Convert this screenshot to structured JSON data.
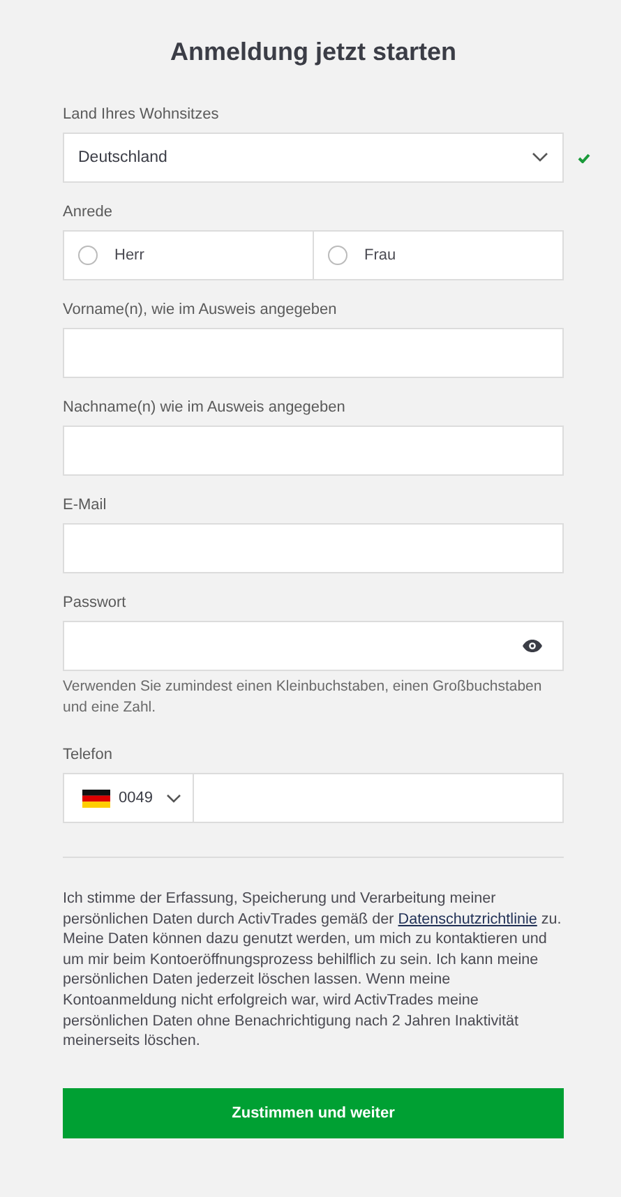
{
  "title": "Anmeldung jetzt starten",
  "fields": [
    {
      "kind": "select",
      "label": "Land Ihres Wohnsitzes",
      "value": "Deutschland",
      "valid": true
    },
    {
      "kind": "radio",
      "label": "Anrede",
      "options": [
        {
          "label": "Herr",
          "selected": false
        },
        {
          "label": "Frau",
          "selected": false
        }
      ]
    },
    {
      "kind": "text",
      "label": "Vorname(n), wie im Ausweis angegeben"
    },
    {
      "kind": "text",
      "label": "Nachname(n) wie im Ausweis angegeben"
    },
    {
      "kind": "text",
      "label": "E-Mail"
    },
    {
      "kind": "password",
      "label": "Passwort",
      "hint": "Verwenden Sie zumindest einen Kleinbuchstaben, einen Großbuchstaben und eine Zahl."
    },
    {
      "kind": "phone",
      "label": "Telefon",
      "code": "0049"
    }
  ],
  "consent": {
    "before": "Ich stimme der Erfassung, Speicherung und Verarbeitung meiner persönlichen Daten durch ActivTrades gemäß der ",
    "link": "Datenschutzrichtlinie",
    "after": " zu. Meine Daten können dazu genutzt werden, um mich zu kontaktieren und um mir beim Kontoeröffnungsprozess behilflich zu sein. Ich kann meine persönlichen Daten jederzeit löschen lassen. Wenn meine Kontoanmeldung nicht erfolgreich war, wird ActivTrades meine persönlichen Daten ohne Benachrichtigung nach 2 Jahren Inaktivität meinerseits löschen."
  },
  "submit": "Zustimmen und weiter"
}
